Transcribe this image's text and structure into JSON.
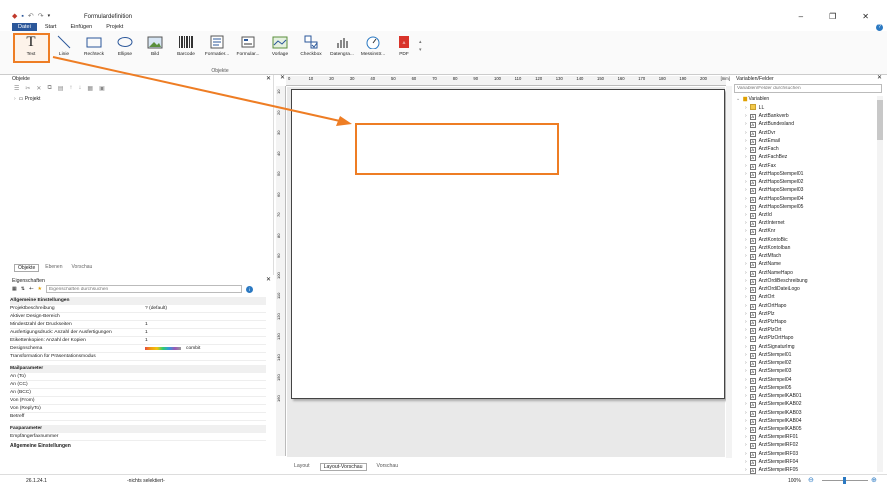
{
  "window": {
    "title": "Formulardefinition"
  },
  "menu_tabs": [
    "Datei",
    "Start",
    "Einfügen",
    "Projekt"
  ],
  "ribbon": {
    "buttons": [
      {
        "label": "Text"
      },
      {
        "label": "Linie"
      },
      {
        "label": "Rechteck"
      },
      {
        "label": "Ellipse"
      },
      {
        "label": "Bild"
      },
      {
        "label": "Barcode"
      },
      {
        "label": "Formatier..."
      },
      {
        "label": "Formular..."
      },
      {
        "label": "Vorlage"
      },
      {
        "label": "Checkbox"
      },
      {
        "label": "Datengra..."
      },
      {
        "label": "Messinstr..."
      },
      {
        "label": "PDF"
      }
    ],
    "group_label": "Objekte"
  },
  "objects_panel": {
    "title": "Objekte",
    "tree_root": "Projekt",
    "tabs": [
      "Objekte",
      "Ebenen",
      "Vorschau"
    ]
  },
  "properties_panel": {
    "title": "Eigenschaften",
    "search_placeholder": "Eigenschaften durchsuchen",
    "sections": [
      {
        "name": "Allgemeine Einstellungen",
        "rows": [
          {
            "k": "Projektbeschreibung",
            "v": "? (default)"
          },
          {
            "k": "Aktiver Design-Bereich",
            "v": ""
          },
          {
            "k": "Mindestzahl der Druckseiten",
            "v": "1"
          },
          {
            "k": "Ausfertigungsdruck: Anzahl der Ausfertigungen",
            "v": "1"
          },
          {
            "k": "Etikettenkopien: Anzahl der Kopien",
            "v": "1"
          },
          {
            "k": "Designschema",
            "v": "combit"
          },
          {
            "k": "Transformation für Präsentationsmodus",
            "v": ""
          }
        ]
      },
      {
        "name": "Mailparameter",
        "rows": [
          {
            "k": "An (To)",
            "v": ""
          },
          {
            "k": "An (CC)",
            "v": ""
          },
          {
            "k": "An (BCC)",
            "v": ""
          },
          {
            "k": "Von (From)",
            "v": ""
          },
          {
            "k": "Von (ReplyTo)",
            "v": ""
          },
          {
            "k": "Betreff",
            "v": ""
          }
        ]
      },
      {
        "name": "Faxparameter",
        "rows": [
          {
            "k": "Empfängerfaxnummer",
            "v": ""
          }
        ]
      }
    ],
    "footer": "Allgemeine Einstellungen"
  },
  "ruler": {
    "top_ticks": [
      "0",
      "10",
      "20",
      "30",
      "40",
      "50",
      "60",
      "70",
      "80",
      "90",
      "100",
      "110",
      "120",
      "130",
      "140",
      "150",
      "160",
      "170",
      "180",
      "190",
      "200",
      "[mm]"
    ],
    "left_ticks": [
      "10",
      "20",
      "30",
      "40",
      "50",
      "60",
      "70",
      "80",
      "90",
      "100",
      "110",
      "120",
      "130",
      "140",
      "150",
      "160"
    ]
  },
  "canvas_tabs": [
    "Layout",
    "Layout-Vorschau",
    "Vorschau"
  ],
  "variables_panel": {
    "title": "Variablen/Felder",
    "search_placeholder": "Variablen/Felder durchsuchen",
    "root": "Variablen",
    "items": [
      "LL",
      "ArztBankverb",
      "ArztBundesland",
      "ArztDvr",
      "ArztEmail",
      "ArztFach",
      "ArztFachBez",
      "ArztFax",
      "ArztHapoStempel01",
      "ArztHapoStempel02",
      "ArztHapoStempel03",
      "ArztHapoStempel04",
      "ArztHapoStempel05",
      "ArztId",
      "ArztInternet",
      "ArztKnr",
      "ArztKontoBic",
      "ArztKontoIban",
      "ArztMfach",
      "ArztName",
      "ArztNameHapo",
      "ArztOrdiBeschreibung",
      "ArztOrdiDateiLogo",
      "ArztOrt",
      "ArztOrtHapo",
      "ArztPlz",
      "ArztPlzHapo",
      "ArztPlzOrt",
      "ArztPlzOrtHapo",
      "ArztSignaturImg",
      "ArztStempel01",
      "ArztStempel02",
      "ArztStempel03",
      "ArztStempel04",
      "ArztStempel05",
      "ArztStempelKAB01",
      "ArztStempelKAB02",
      "ArztStempelKAB03",
      "ArztStempelKAB04",
      "ArztStempelKAB05",
      "ArztStempelRF01",
      "ArztStempelRF02",
      "ArztStempelRF03",
      "ArztStempelRF04",
      "ArztStempelRF05"
    ]
  },
  "status": {
    "version": "26.1.24.1",
    "selection": "-nichts selektiert-",
    "zoom": "100%"
  },
  "colors": {
    "accent": "#2b579a",
    "highlight": "#ee7d24"
  }
}
